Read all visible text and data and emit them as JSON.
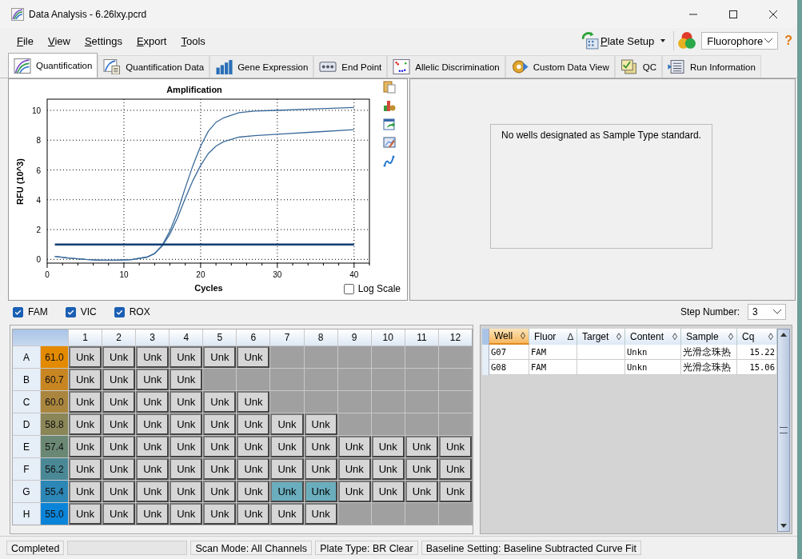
{
  "window": {
    "title": "Data Analysis - 6.26lxy.pcrd"
  },
  "menu": [
    "File",
    "View",
    "Settings",
    "Export",
    "Tools"
  ],
  "toolbar": {
    "plate_setup": "Plate Setup",
    "fluorophore": "Fluorophore",
    "help": "?"
  },
  "tabs": [
    {
      "label": "Quantification",
      "kind": "curve",
      "selected": true
    },
    {
      "label": "Quantification Data",
      "kind": "sheet",
      "selected": false
    },
    {
      "label": "Gene Expression",
      "kind": "bars",
      "selected": false
    },
    {
      "label": "End Point",
      "kind": "dots",
      "selected": false
    },
    {
      "label": "Allelic Discrimination",
      "kind": "scatter",
      "selected": false
    },
    {
      "label": "Custom Data View",
      "kind": "gear",
      "selected": false
    },
    {
      "label": "QC",
      "kind": "check",
      "selected": false
    },
    {
      "label": "Run Information",
      "kind": "list",
      "selected": false
    }
  ],
  "amplification": {
    "chart_data": {
      "type": "line",
      "title": "Amplification",
      "xlabel": "Cycles",
      "ylabel": "RFU (10^3)",
      "x": [
        1,
        3,
        5,
        7,
        9,
        11,
        13,
        14,
        15,
        16,
        17,
        18,
        19,
        20,
        21,
        22,
        23,
        25,
        27,
        30,
        35,
        40
      ],
      "series": [
        {
          "color": "#3a6a9a",
          "values": [
            0.2,
            0.08,
            0.0,
            -0.05,
            -0.05,
            -0.02,
            0.15,
            0.4,
            0.95,
            1.9,
            3.2,
            4.8,
            6.3,
            7.6,
            8.6,
            9.2,
            9.5,
            9.85,
            9.95,
            10.0,
            10.1,
            10.2
          ]
        },
        {
          "color": "#3a6a9a",
          "values": [
            0.2,
            0.08,
            0.0,
            -0.05,
            -0.05,
            -0.02,
            0.15,
            0.38,
            0.9,
            1.7,
            2.8,
            4.1,
            5.3,
            6.3,
            7.1,
            7.6,
            7.9,
            8.2,
            8.3,
            8.4,
            8.55,
            8.7
          ]
        },
        {
          "color": "#0b3d73",
          "values": [
            1,
            1,
            1,
            1,
            1,
            1,
            1,
            1,
            1,
            1,
            1,
            1,
            1,
            1,
            1,
            1,
            1,
            1,
            1,
            1,
            1,
            1
          ]
        }
      ],
      "grid": true,
      "xlim": [
        0,
        42
      ],
      "ylim": [
        -0.25,
        10.75
      ],
      "xticks": [
        0,
        10,
        20,
        30,
        40
      ],
      "yticks": [
        0,
        2,
        4,
        6,
        8,
        10
      ]
    },
    "log_scale": {
      "label": "Log Scale",
      "checked": false
    }
  },
  "standard_curve": {
    "message": "No wells designated as Sample Type standard."
  },
  "channels": [
    {
      "label": "FAM",
      "checked": true
    },
    {
      "label": "VIC",
      "checked": true
    },
    {
      "label": "ROX",
      "checked": true
    }
  ],
  "step_number": {
    "label": "Step Number:",
    "value": "3"
  },
  "plate": {
    "columns": [
      "1",
      "2",
      "3",
      "4",
      "5",
      "6",
      "7",
      "8",
      "9",
      "10",
      "11",
      "12"
    ],
    "rows": [
      {
        "label": "A",
        "temperature": "61.0",
        "color": "#e38a00",
        "wells": [
          {
            "label": "Unk",
            "selected": false
          },
          {
            "label": "Unk",
            "selected": false
          },
          {
            "label": "Unk",
            "selected": false
          },
          {
            "label": "Unk",
            "selected": false
          },
          {
            "label": "Unk",
            "selected": false
          },
          {
            "label": "Unk",
            "selected": false
          }
        ]
      },
      {
        "label": "B",
        "temperature": "60.7",
        "color": "#c88622",
        "wells": [
          {
            "label": "Unk",
            "selected": false
          },
          {
            "label": "Unk",
            "selected": false
          },
          {
            "label": "Unk",
            "selected": false
          },
          {
            "label": "Unk",
            "selected": false
          }
        ]
      },
      {
        "label": "C",
        "temperature": "60.0",
        "color": "#aa853e",
        "wells": [
          {
            "label": "Unk",
            "selected": false
          },
          {
            "label": "Unk",
            "selected": false
          },
          {
            "label": "Unk",
            "selected": false
          },
          {
            "label": "Unk",
            "selected": false
          },
          {
            "label": "Unk",
            "selected": false
          },
          {
            "label": "Unk",
            "selected": false
          }
        ]
      },
      {
        "label": "D",
        "temperature": "58.8",
        "color": "#8b8658",
        "wells": [
          {
            "label": "Unk",
            "selected": false
          },
          {
            "label": "Unk",
            "selected": false
          },
          {
            "label": "Unk",
            "selected": false
          },
          {
            "label": "Unk",
            "selected": false
          },
          {
            "label": "Unk",
            "selected": false
          },
          {
            "label": "Unk",
            "selected": false
          },
          {
            "label": "Unk",
            "selected": false
          },
          {
            "label": "Unk",
            "selected": false
          }
        ]
      },
      {
        "label": "E",
        "temperature": "57.4",
        "color": "#6a8874",
        "wells": [
          {
            "label": "Unk",
            "selected": false
          },
          {
            "label": "Unk",
            "selected": false
          },
          {
            "label": "Unk",
            "selected": false
          },
          {
            "label": "Unk",
            "selected": false
          },
          {
            "label": "Unk",
            "selected": false
          },
          {
            "label": "Unk",
            "selected": false
          },
          {
            "label": "Unk",
            "selected": false
          },
          {
            "label": "Unk",
            "selected": false
          },
          {
            "label": "Unk",
            "selected": false
          },
          {
            "label": "Unk",
            "selected": false
          },
          {
            "label": "Unk",
            "selected": false
          },
          {
            "label": "Unk",
            "selected": false
          }
        ]
      },
      {
        "label": "F",
        "temperature": "56.2",
        "color": "#4a8896",
        "wells": [
          {
            "label": "Unk",
            "selected": false
          },
          {
            "label": "Unk",
            "selected": false
          },
          {
            "label": "Unk",
            "selected": false
          },
          {
            "label": "Unk",
            "selected": false
          },
          {
            "label": "Unk",
            "selected": false
          },
          {
            "label": "Unk",
            "selected": false
          },
          {
            "label": "Unk",
            "selected": false
          },
          {
            "label": "Unk",
            "selected": false
          },
          {
            "label": "Unk",
            "selected": false
          },
          {
            "label": "Unk",
            "selected": false
          },
          {
            "label": "Unk",
            "selected": false
          },
          {
            "label": "Unk",
            "selected": false
          }
        ]
      },
      {
        "label": "G",
        "temperature": "55.4",
        "color": "#2c86b6",
        "wells": [
          {
            "label": "Unk",
            "selected": false
          },
          {
            "label": "Unk",
            "selected": false
          },
          {
            "label": "Unk",
            "selected": false
          },
          {
            "label": "Unk",
            "selected": false
          },
          {
            "label": "Unk",
            "selected": false
          },
          {
            "label": "Unk",
            "selected": false
          },
          {
            "label": "Unk",
            "selected": true
          },
          {
            "label": "Unk",
            "selected": true
          },
          {
            "label": "Unk",
            "selected": false
          },
          {
            "label": "Unk",
            "selected": false
          },
          {
            "label": "Unk",
            "selected": false
          },
          {
            "label": "Unk",
            "selected": false
          }
        ]
      },
      {
        "label": "H",
        "temperature": "55.0",
        "color": "#0a84d8",
        "wells": [
          {
            "label": "Unk",
            "selected": false
          },
          {
            "label": "Unk",
            "selected": false
          },
          {
            "label": "Unk",
            "selected": false
          },
          {
            "label": "Unk",
            "selected": false
          },
          {
            "label": "Unk",
            "selected": false
          },
          {
            "label": "Unk",
            "selected": false
          },
          {
            "label": "Unk",
            "selected": false
          },
          {
            "label": "Unk",
            "selected": false
          }
        ]
      }
    ]
  },
  "well_table": {
    "columns": [
      {
        "label": "Well",
        "sort": "◊",
        "selected": true
      },
      {
        "label": "Fluor",
        "sort": "∆",
        "selected": false
      },
      {
        "label": "Target",
        "sort": "◊",
        "selected": false
      },
      {
        "label": "Content",
        "sort": "◊",
        "selected": false
      },
      {
        "label": "Sample",
        "sort": "◊",
        "selected": false
      },
      {
        "label": "Cq",
        "sort": "◊",
        "selected": false
      }
    ],
    "rows": [
      {
        "well": "G07",
        "fluor": "FAM",
        "content": "Unkn",
        "sample": "光滑念珠热",
        "cq": "15.22"
      },
      {
        "well": "G08",
        "fluor": "FAM",
        "content": "Unkn",
        "sample": "光滑念珠热",
        "cq": "15.06"
      }
    ]
  },
  "status_bar": {
    "state": "Completed",
    "progress": {
      "level": 0
    },
    "items": [
      "Scan Mode: All Channels",
      "Plate Type: BR Clear",
      "Baseline Setting: Baseline Subtracted Curve Fit"
    ]
  }
}
